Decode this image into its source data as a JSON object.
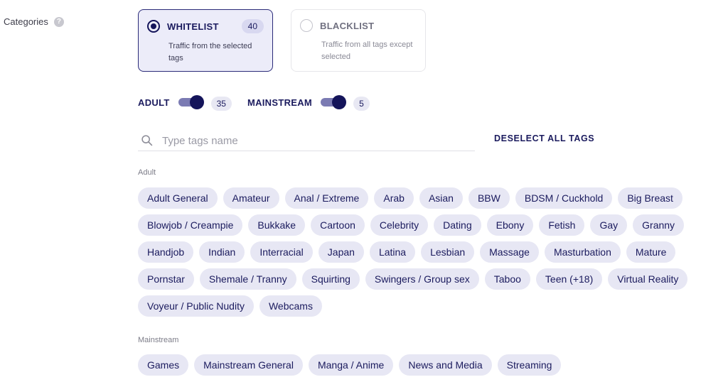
{
  "categories": {
    "label": "Categories",
    "help_icon": "question-circle-icon"
  },
  "modes": [
    {
      "title": "WHITELIST",
      "count": "40",
      "description": "Traffic from the selected tags",
      "selected": true
    },
    {
      "title": "BLACKLIST",
      "description": "Traffic from all tags except selected",
      "selected": false
    }
  ],
  "toggles": [
    {
      "label": "ADULT",
      "count": "35",
      "on": true
    },
    {
      "label": "MAINSTREAM",
      "count": "5",
      "on": true
    }
  ],
  "search": {
    "placeholder": "Type tags name",
    "icon": "search-icon"
  },
  "deselect_label": "DESELECT ALL TAGS",
  "sections": [
    {
      "label": "Adult",
      "tags": [
        "Adult General",
        "Amateur",
        "Anal / Extreme",
        "Arab",
        "Asian",
        "BBW",
        "BDSM / Cuckhold",
        "Big Breast",
        "Blowjob / Creampie",
        "Bukkake",
        "Cartoon",
        "Celebrity",
        "Dating",
        "Ebony",
        "Fetish",
        "Gay",
        "Granny",
        "Handjob",
        "Indian",
        "Interracial",
        "Japan",
        "Latina",
        "Lesbian",
        "Massage",
        "Masturbation",
        "Mature",
        "Pornstar",
        "Shemale / Tranny",
        "Squirting",
        "Swingers / Group sex",
        "Taboo",
        "Teen (+18)",
        "Virtual Reality",
        "Voyeur / Public Nudity",
        "Webcams"
      ]
    },
    {
      "label": "Mainstream",
      "tags": [
        "Games",
        "Mainstream General",
        "Manga / Anime",
        "News and Media",
        "Streaming"
      ]
    }
  ]
}
